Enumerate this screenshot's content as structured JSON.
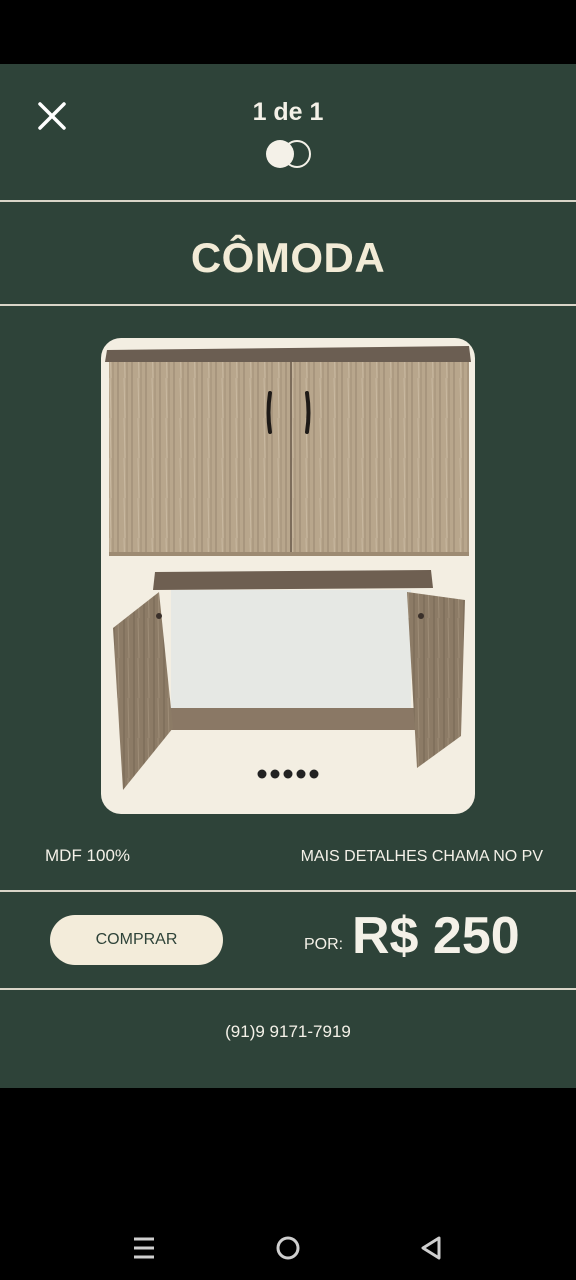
{
  "viewer": {
    "counter": "1 de 1"
  },
  "post": {
    "title": "CÔMODA",
    "material": "MDF 100%",
    "details": "MAIS DETALHES CHAMA NO PV",
    "buy_label": "COMPRAR",
    "price_prefix": "POR:",
    "price": "R$ 250",
    "phone": "(91)9 9171-7919",
    "carousel_dots": 5
  },
  "colors": {
    "background": "#2e4339",
    "cream": "#f3ecda",
    "text": "#f4f1e8"
  },
  "navbar": {
    "icons": [
      "menu-icon",
      "home-icon",
      "back-icon"
    ]
  }
}
